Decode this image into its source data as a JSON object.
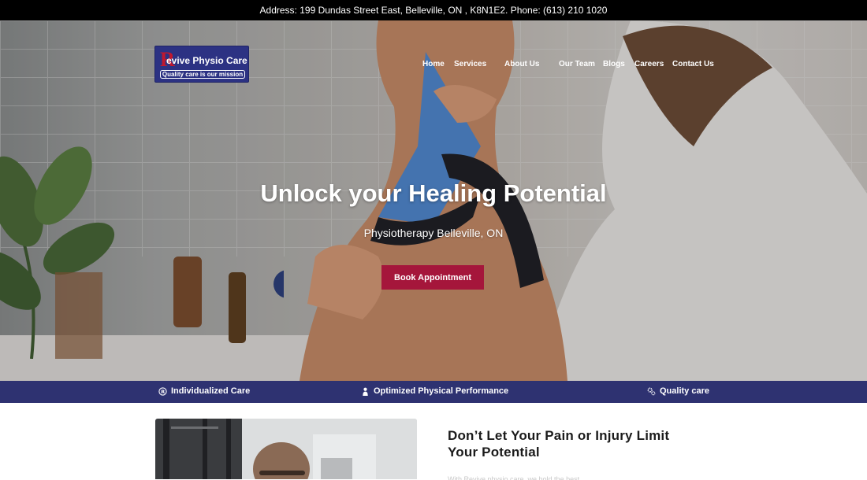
{
  "topbar": {
    "text": "Address: 199 Dundas Street East, Belleville, ON , K8N1E2.   Phone: (613) 210 1020"
  },
  "logo": {
    "name": "evive Physio Care",
    "letter": "R",
    "tagline": "Quality care is our mission"
  },
  "nav": {
    "items": [
      "Home",
      "Services",
      "About Us",
      "Our Team",
      "Blogs",
      "Careers",
      "Contact Us"
    ]
  },
  "hero": {
    "title": "Unlock your Healing Potential",
    "subtitle": "Physiotherapy Belleville, ON",
    "cta_label": "Book Appointment"
  },
  "features": {
    "items": [
      {
        "icon": "registered-icon",
        "label": "Individualized Care"
      },
      {
        "icon": "person-icon",
        "label": "Optimized Physical Performance"
      },
      {
        "icon": "gears-icon",
        "label": "Quality care"
      }
    ]
  },
  "intro": {
    "heading": "Don’t Let Your Pain or Injury Limit Your Potential",
    "text_fragment": "With Revive physio care, we hold the best ..."
  },
  "colors": {
    "brand_navy": "#2e3271",
    "cta_red": "#a5163b",
    "topbar": "#000000"
  }
}
